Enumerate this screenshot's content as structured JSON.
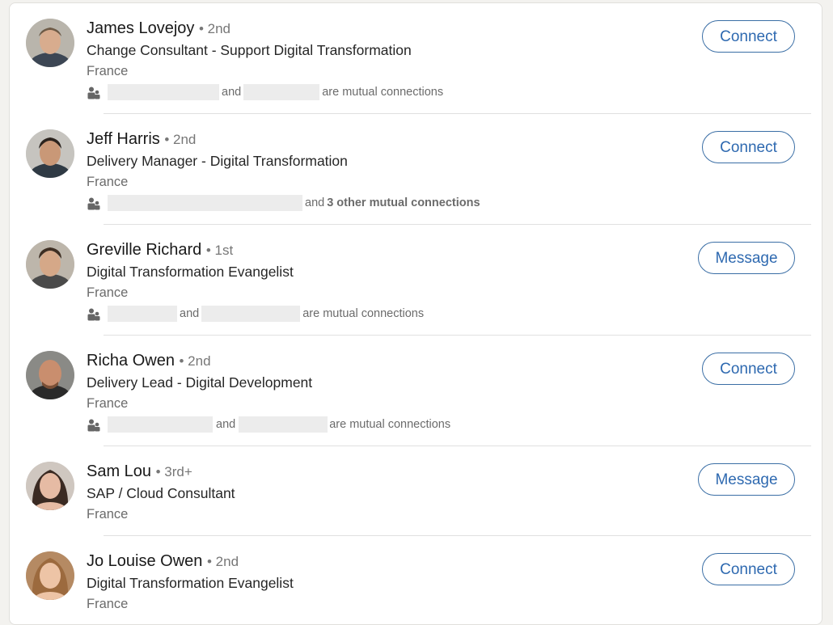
{
  "results": [
    {
      "name": "James Lovejoy",
      "degree": "• 2nd",
      "headline": "Change Consultant - Support Digital Transformation",
      "location": "France",
      "mutual": {
        "and": "and",
        "suffix": "are mutual connections"
      },
      "button": "Connect"
    },
    {
      "name": "Jeff Harris",
      "degree": "• 2nd",
      "headline": "Delivery Manager - Digital Transformation",
      "location": "France",
      "mutual": {
        "and": "and",
        "other": "3 other mutual connections"
      },
      "button": "Connect"
    },
    {
      "name": "Greville Richard",
      "degree": "• 1st",
      "headline": "Digital Transformation Evangelist",
      "location": "France",
      "mutual": {
        "and": "and",
        "suffix": "are mutual connections"
      },
      "button": "Message"
    },
    {
      "name": "Richa Owen",
      "degree": "• 2nd",
      "headline": "Delivery Lead - Digital Development",
      "location": "France",
      "mutual": {
        "and": "and",
        "suffix": "are mutual connections"
      },
      "button": "Connect"
    },
    {
      "name": "Sam Lou",
      "degree": "• 3rd+",
      "headline": "SAP / Cloud Consultant",
      "location": "France",
      "button": "Message"
    },
    {
      "name": "Jo Louise Owen",
      "degree": "• 2nd",
      "headline": "Digital Transformation Evangelist",
      "location": "France",
      "button": "Connect"
    }
  ],
  "icons": {
    "mutual": "people-icon",
    "avatar": "profile-photo"
  },
  "colors": {
    "accent": "#2e69b0",
    "divider": "#e0e0e0",
    "redaction": "#ececec"
  }
}
